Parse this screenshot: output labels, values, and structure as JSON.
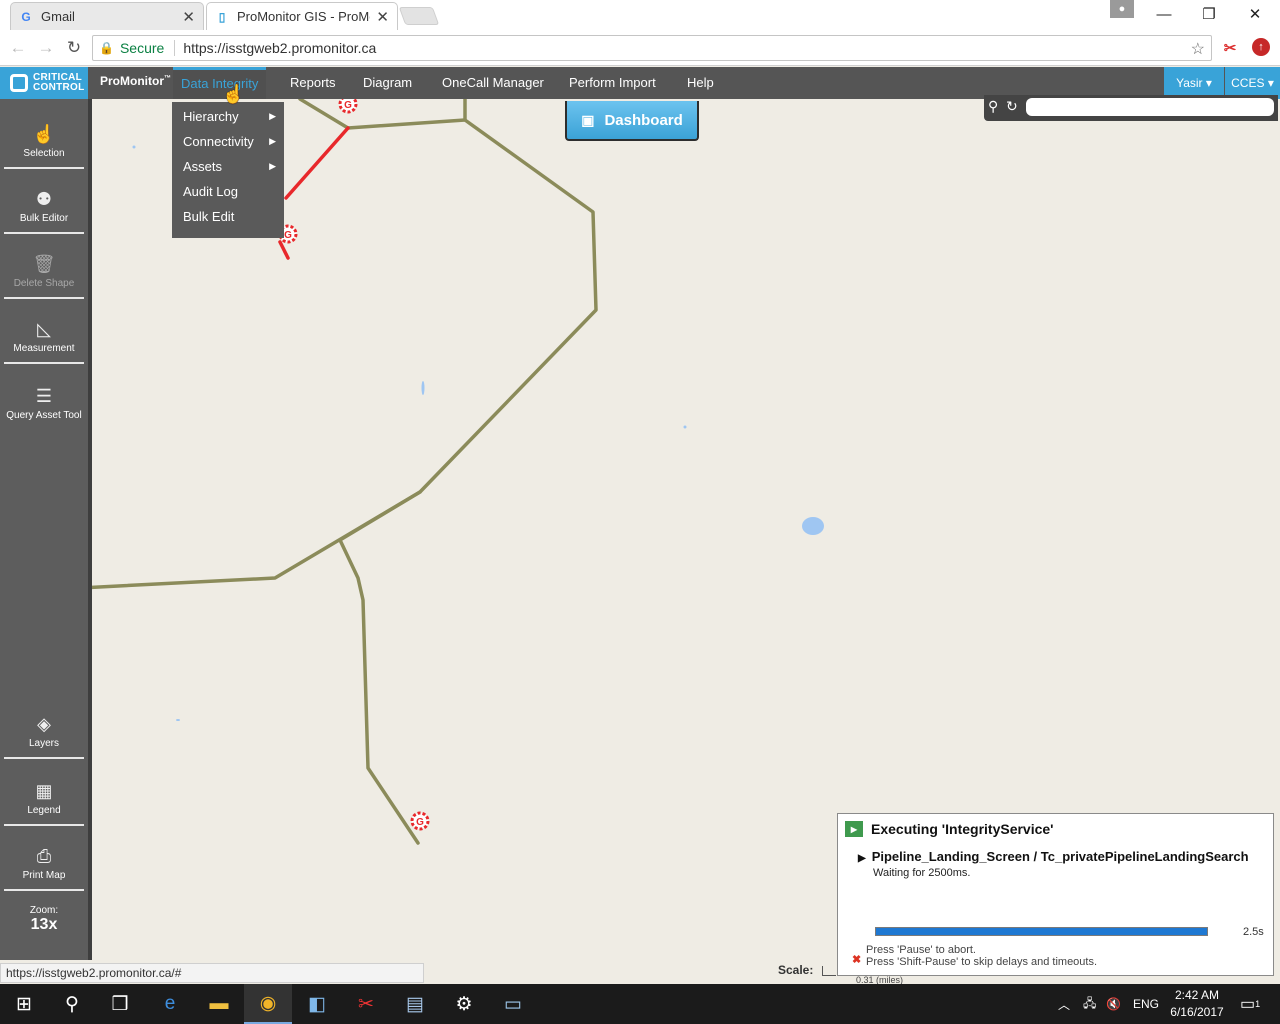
{
  "browser": {
    "tabs": [
      {
        "title": "Gmail",
        "favicon": "G"
      },
      {
        "title": "ProMonitor GIS - ProMo",
        "favicon": "▯"
      }
    ],
    "security_label": "Secure",
    "url": "https://isstgweb2.promonitor.ca",
    "status_url": "https://isstgweb2.promonitor.ca/#"
  },
  "app": {
    "logo_line1": "CRITICAL",
    "logo_line2": "CONTROL",
    "brand": "ProMonitor",
    "brand_tm": "™",
    "menu": [
      "Data Integrity",
      "Reports",
      "Diagram",
      "OneCall Manager",
      "Perform Import",
      "Help"
    ],
    "user": "Yasir ▾",
    "company": "CCES ▾",
    "dashboard_label": "Dashboard",
    "search_value": ""
  },
  "dropdown": {
    "items": [
      {
        "label": "Hierarchy",
        "arrow": "▶"
      },
      {
        "label": "Connectivity",
        "arrow": "▶"
      },
      {
        "label": "Assets",
        "arrow": "▶"
      },
      {
        "label": "Audit Log",
        "arrow": ""
      },
      {
        "label": "Bulk Edit",
        "arrow": ""
      }
    ]
  },
  "toolbar": {
    "tools": [
      "Selection",
      "Bulk Editor",
      "Delete Shape",
      "Measurement",
      "Query Asset Tool"
    ],
    "bottom_tools": [
      "Layers",
      "Legend",
      "Print Map"
    ],
    "zoom_label": "Zoom:",
    "zoom_value": "13x"
  },
  "map": {
    "pipeline_color": "#8b8b5a",
    "highlight_color": "#e8282b",
    "water_color": "#9fc6f2",
    "marker_label": "G",
    "scale_label": "Scale:",
    "scale_text": "0.31 (miles)"
  },
  "exec_panel": {
    "title": "Executing 'IntegrityService'",
    "step": "Pipeline_Landing_Screen / Tc_privatePipelineLandingSearch",
    "wait": "Waiting for 2500ms.",
    "progress": 1.0,
    "time": "2.5s",
    "hint1": "Press 'Pause' to abort.",
    "hint2": "Press 'Shift-Pause' to skip delays and timeouts."
  },
  "taskbar": {
    "lang": "ENG",
    "time": "2:42 AM",
    "date": "6/16/2017",
    "notif_count": "1"
  }
}
